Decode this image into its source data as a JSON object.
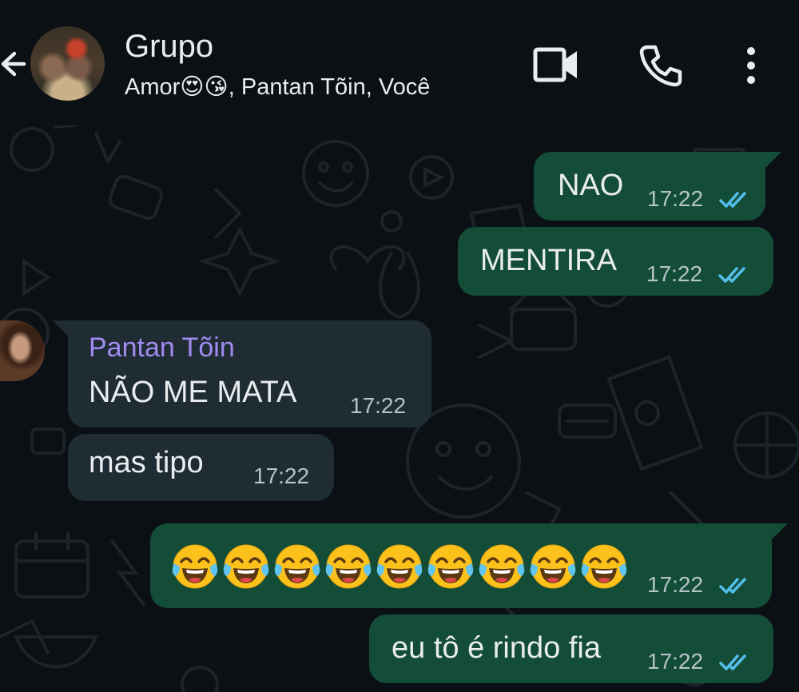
{
  "header": {
    "title": "Grupo",
    "subtitle": "Amor😍😘, Pantan Tõin, Você"
  },
  "messages": [
    {
      "id": "m1",
      "direction": "outgoing",
      "text": "NAO",
      "time": "17:22",
      "status": "read"
    },
    {
      "id": "m2",
      "direction": "outgoing",
      "text": "MENTIRA",
      "time": "17:22",
      "status": "read"
    },
    {
      "id": "m3",
      "direction": "incoming",
      "sender": "Pantan Tõin",
      "text": "NÃO ME MATA",
      "time": "17:22"
    },
    {
      "id": "m4",
      "direction": "incoming",
      "text": "mas tipo",
      "time": "17:22"
    },
    {
      "id": "m5",
      "direction": "outgoing",
      "text": "😂😂😂😂😂😂😂😂😂",
      "emoji_count": 9,
      "time": "17:22",
      "status": "read"
    },
    {
      "id": "m6",
      "direction": "outgoing",
      "text": "eu tô é rindo fia",
      "time": "17:22",
      "status": "read"
    }
  ],
  "icons": {
    "back": "arrow-back-icon",
    "video": "video-call-icon",
    "call": "phone-icon",
    "menu": "more-vertical-icon"
  },
  "colors": {
    "background": "#0b1014",
    "outgoing_bubble": "#144d37",
    "incoming_bubble": "#1f2c34",
    "read_ticks": "#53bdeb",
    "sender_name": "#a28bf0"
  }
}
